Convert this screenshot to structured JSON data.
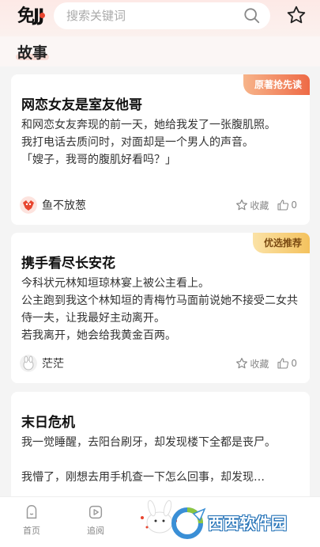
{
  "header": {
    "logo_text": "免JJ",
    "search_placeholder": "搜索关键词"
  },
  "section": {
    "title": "故事"
  },
  "cards": [
    {
      "badge": "原著抢先读",
      "title": "网恋女友是室友他哥",
      "lines": [
        "和网恋女友奔现的前一天，她给我发了一张腹肌照。",
        "我打电话去质问时，对面却是一个男人的声音。",
        "「嫂子，我哥的腹肌好看吗？」"
      ],
      "author": "鱼不放葱",
      "collect_label": "收藏",
      "likes": "0"
    },
    {
      "badge": "优选推荐",
      "title": "携手看尽长安花",
      "lines": [
        "今科状元林知垣琼林宴上被公主看上。",
        "公主跑到我这个林知垣的青梅竹马面前说她不接受二女共侍一夫，让我最好主动离开。",
        "若我离开，她会给我黄金百两。"
      ],
      "author": "茫茫",
      "collect_label": "收藏",
      "likes": "0"
    },
    {
      "title": "末日危机",
      "lines": [
        "我一觉睡醒，去阳台刷牙，却发现楼下全都是丧尸。",
        "",
        "我懵了，刚想去用手机查一下怎么回事，却发现…"
      ]
    }
  ],
  "nav": {
    "home": "首页",
    "follow": "追阅"
  },
  "watermark": "西西软件园",
  "colors": {
    "accent": "#e8452f",
    "badge_red": "#ee6a46",
    "badge_gold": "#f4c25e"
  }
}
